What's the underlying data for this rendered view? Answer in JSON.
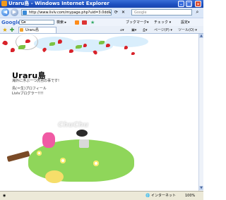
{
  "window": {
    "title": "Uraru島 - Windows Internet Explorer"
  },
  "address": {
    "url": "http://www.livlv.com/mypage.php?uid=3.0dd&s=2",
    "search_placeholder": "Google"
  },
  "google_toolbar": {
    "logo": "Google",
    "search_label": "G▾",
    "items": [
      "検索 ▸",
      "ブックマーク▾",
      "チェック ▾",
      "設定▾"
    ]
  },
  "tab": {
    "label": "Uraru島"
  },
  "tab_tools": [
    "ページ(P) ▾",
    "ツール(O) ▾"
  ],
  "page": {
    "title": "Uraru島",
    "subtitle": "海外に浮ぶ一つ虎島の事です!",
    "line1": "島(＝生)プロフィール",
    "line2": "Livlvブログラー!!!!",
    "sign": "ChuChu"
  },
  "status": {
    "zone": "インターネット",
    "zoom": "100%"
  }
}
